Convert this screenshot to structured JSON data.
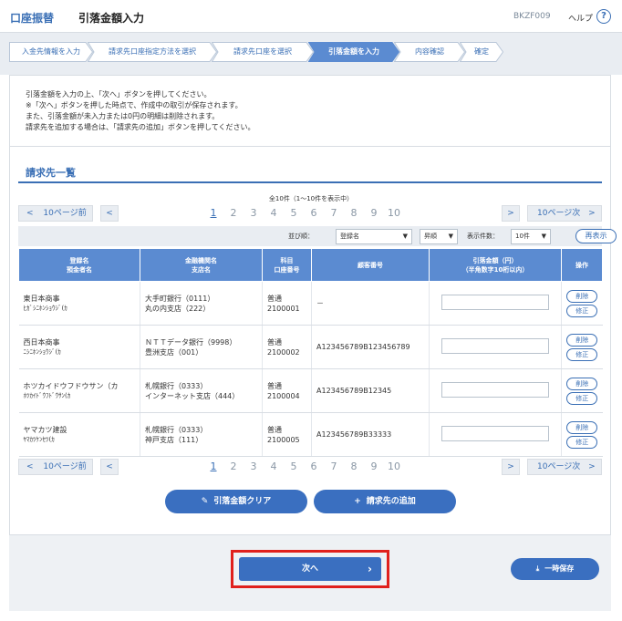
{
  "header": {
    "category": "口座振替",
    "title": "引落金額入力",
    "screen_code": "BKZF009",
    "help_label": "ヘルプ",
    "help_icon": "?"
  },
  "steps": [
    {
      "label": "入金先情報を入力",
      "active": false
    },
    {
      "label": "請求先口座指定方法を選択",
      "active": false
    },
    {
      "label": "請求先口座を選択",
      "active": false
    },
    {
      "label": "引落金額を入力",
      "active": true
    },
    {
      "label": "内容確認",
      "active": false
    },
    {
      "label": "確定",
      "active": false
    }
  ],
  "instructions": [
    "引落金額を入力の上、「次へ」ボタンを押してください。",
    "※「次へ」ボタンを押した時点で、作成中の取引が保存されます。",
    "また、引落金額が未入力または0円の明細は削除されます。",
    "請求先を追加する場合は、「請求先の追加」ボタンを押してください。"
  ],
  "section_title": "請求先一覧",
  "total_text": "全10件（1～10件を表示中）",
  "pager": {
    "prev10": "10ページ前",
    "next10": "10ページ次",
    "prev_icon": "<",
    "next_icon": ">",
    "pages": [
      "1",
      "2",
      "3",
      "4",
      "5",
      "6",
      "7",
      "8",
      "9",
      "10"
    ],
    "current": "1"
  },
  "sortbar": {
    "sort_label": "並び順：",
    "sort_value": "登録名",
    "order_value": "昇順",
    "count_label": "表示件数：",
    "count_value": "10件",
    "redisplay": "再表示"
  },
  "table": {
    "headers": [
      [
        "登録名",
        "預金者名"
      ],
      [
        "金融機関名",
        "支店名"
      ],
      [
        "科目",
        "口座番号"
      ],
      [
        "顧客番号"
      ],
      [
        "引落金額（円）",
        "（半角数字10桁以内）"
      ],
      [
        "操作"
      ]
    ],
    "rows": [
      {
        "name": "東日本商事",
        "kana": "ﾋｶﾞｼﾆﾎﾝｼｮｳｼﾞ(ｶ",
        "bank": "大手町銀行（0111）",
        "branch": "丸の内支店（222）",
        "type": "普通",
        "account": "2100001",
        "customer": "－",
        "amount": ""
      },
      {
        "name": "西日本商事",
        "kana": "ﾆｼﾆﾎﾝｼｮｳｼﾞ(ｶ",
        "bank": "ＮＴＴデータ銀行（9998）",
        "branch": "豊洲支店（001）",
        "type": "普通",
        "account": "2100002",
        "customer": "A123456789B123456789",
        "amount": ""
      },
      {
        "name": "ホツカイドウフドウサン（カ",
        "kana": "ﾎﾂｶｲﾄﾞｳﾌﾄﾞｳｻﾝ(ｶ",
        "bank": "札幌銀行（0333）",
        "branch": "インターネット支店（444）",
        "type": "普通",
        "account": "2100004",
        "customer": "A123456789B12345",
        "amount": ""
      },
      {
        "name": "ヤマカツ建設",
        "kana": "ﾔﾏｶﾂｹﾝｾﾂ(ｶ",
        "bank": "札幌銀行（0333）",
        "branch": "神戸支店（111）",
        "type": "普通",
        "account": "2100005",
        "customer": "A123456789B33333",
        "amount": ""
      }
    ],
    "delete_label": "削除",
    "edit_label": "修正"
  },
  "buttons": {
    "clear_amount": "引落金額クリア",
    "add_payer": "請求先の追加",
    "next": "次へ",
    "temp_save": "一時保存"
  },
  "colors": {
    "accent": "#3a6fb5",
    "button": "#3a6fc0",
    "table_header": "#5b8bd1",
    "highlight_frame": "#e0201c"
  }
}
